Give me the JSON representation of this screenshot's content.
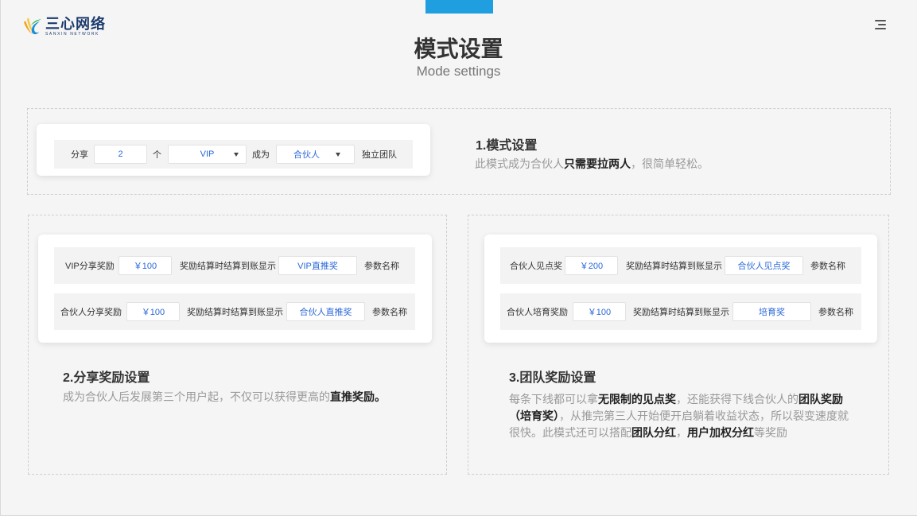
{
  "brand": {
    "logo_cn": "三心网络",
    "logo_en": "SANXIN NETWORK"
  },
  "header": {
    "title": "模式设置",
    "subtitle": "Mode settings"
  },
  "mode": {
    "share_label": "分享",
    "share_count": "2",
    "unit": "个",
    "level_value": "VIP",
    "become_label": "成为",
    "role_value": "合伙人",
    "suffix": "独立团队",
    "heading": "1.模式设置",
    "desc_pre": "此模式成为合伙人",
    "desc_bold": "只需要拉两人",
    "desc_post": "，很简单轻松。"
  },
  "share_reward": {
    "rows": [
      {
        "label": "VIP分享奖励",
        "amount": "￥100",
        "mid": "奖励结算时结算到账显示",
        "name": "VIP直推奖",
        "tail": "参数名称"
      },
      {
        "label": "合伙人分享奖励",
        "amount": "￥100",
        "mid": "奖励结算时结算到账显示",
        "name": "合伙人直推奖",
        "tail": "参数名称"
      }
    ],
    "heading": "2.分享奖励设置",
    "desc_pre": "成为合伙人后发展第三个用户起，不仅可以获得更高的",
    "desc_bold": "直推奖励。"
  },
  "team_reward": {
    "rows": [
      {
        "label": "合伙人见点奖",
        "amount": "￥200",
        "mid": "奖励结算时结算到账显示",
        "name": "合伙人见点奖",
        "tail": "参数名称"
      },
      {
        "label": "合伙人培育奖励",
        "amount": "￥100",
        "mid": "奖励结算时结算到账显示",
        "name": "培育奖",
        "tail": "参数名称"
      }
    ],
    "heading": "3.团队奖励设置",
    "d1": "每条下线都可以拿",
    "b1": "无限制的见点奖",
    "d2": "，还能获得下线合伙人的",
    "b2": "团队奖励（培育奖）",
    "d3": "，从推完第三人开始便开启躺着收益状态，所以裂变速度就很快。此模式还可以搭配",
    "b3": "团队分红",
    "d4": "，",
    "b4": "用户加权分红",
    "d5": "等奖励"
  },
  "colors": {
    "accent": "#1f9ee0",
    "value_blue": "#2a68d8"
  }
}
